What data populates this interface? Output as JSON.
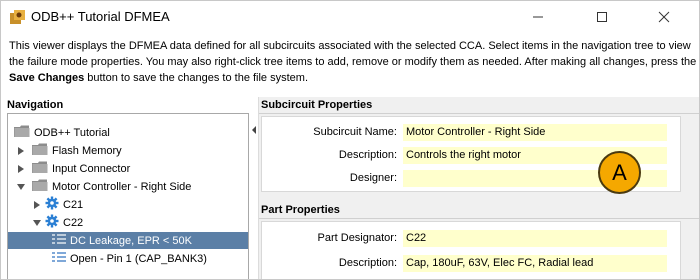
{
  "window": {
    "title": "ODB++ Tutorial DFMEA"
  },
  "description": {
    "part1": "This viewer displays the DFMEA data defined for all subcircuits associated with the selected CCA. Select items in the navigation tree to view the failure mode properties. You may also right-click tree items to add, remove or modify them as needed. After making all changes, press the ",
    "bold1": "Save Changes",
    "part2": " button to save the changes to the file system."
  },
  "navigation": {
    "header": "Navigation",
    "items": [
      {
        "label": "ODB++ Tutorial",
        "icon": "folder-icon",
        "expander": "none",
        "level": 0
      },
      {
        "label": "Flash Memory",
        "icon": "folder-icon",
        "expander": "collapsed",
        "level": 1
      },
      {
        "label": "Input Connector",
        "icon": "folder-icon",
        "expander": "collapsed",
        "level": 1
      },
      {
        "label": "Motor Controller - Right Side",
        "icon": "folder-icon",
        "expander": "expanded",
        "level": 1
      },
      {
        "label": "C21",
        "icon": "gear-icon",
        "expander": "collapsed",
        "level": 2
      },
      {
        "label": "C22",
        "icon": "gear-icon",
        "expander": "expanded",
        "level": 2
      },
      {
        "label": "DC Leakage, EPR < 50K",
        "icon": "failure-mode-icon",
        "expander": "none",
        "level": 3,
        "selected": true
      },
      {
        "label": "Open - Pin 1 (CAP_BANK3)",
        "icon": "failure-mode-icon",
        "expander": "none",
        "level": 3
      }
    ]
  },
  "subcircuit": {
    "header": "Subcircuit Properties",
    "fields": [
      {
        "label": "Subcircuit Name:",
        "value": "Motor Controller - Right Side"
      },
      {
        "label": "Description:",
        "value": "Controls the right motor"
      },
      {
        "label": "Designer:",
        "value": ""
      }
    ]
  },
  "part": {
    "header": "Part Properties",
    "fields": [
      {
        "label": "Part Designator:",
        "value": "C22"
      },
      {
        "label": "Description:",
        "value": "Cap, 180uF, 63V, Elec FC, Radial lead"
      }
    ]
  },
  "callout": {
    "label": "A"
  },
  "colors": {
    "selection": "#5b7fa6",
    "input_background": "#ffffcc",
    "callout": "#f5a800",
    "folder": "#7a7a7a",
    "gear": "#2a7fd4"
  }
}
